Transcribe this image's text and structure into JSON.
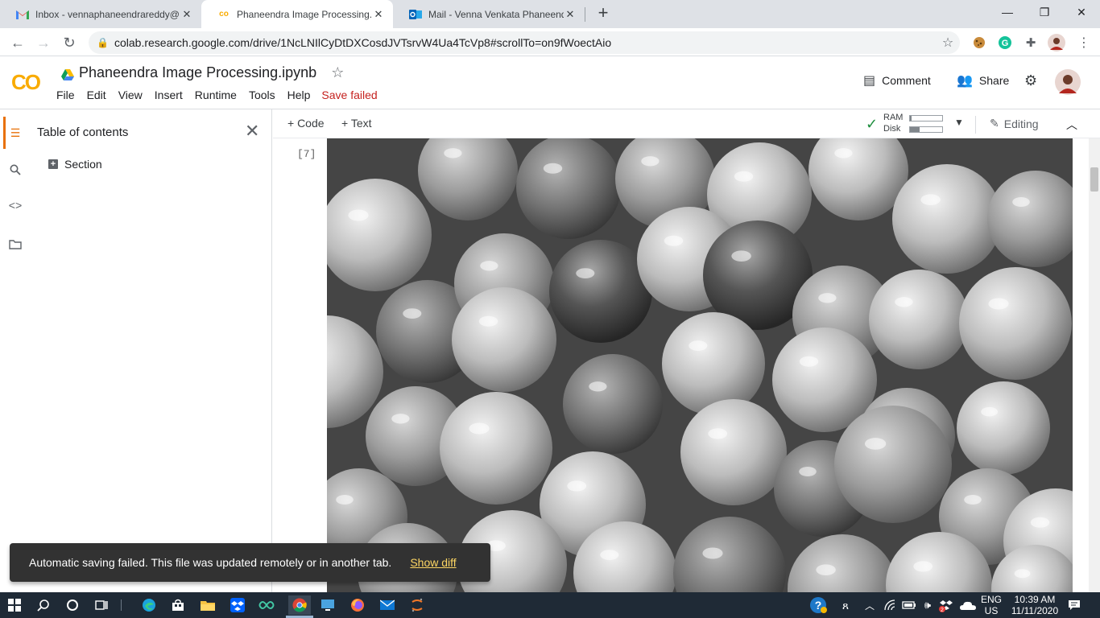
{
  "browser": {
    "tabs": [
      {
        "title": "Inbox - vennaphaneendrareddy@",
        "icon": "gmail-icon"
      },
      {
        "title": "Phaneendra Image Processing.ipynb",
        "icon": "colab-icon",
        "active": true
      },
      {
        "title": "Mail - Venna Venkata Phaneendra",
        "icon": "outlook-icon"
      }
    ],
    "new_tab": "+",
    "url": "colab.research.google.com/drive/1NcLNIlCyDtDXCosdJVTsrvW4Ua4TcVp8#scrollTo=on9fWoectAio"
  },
  "colab": {
    "logo": "CO",
    "doc_title": "Phaneendra Image Processing.ipynb",
    "menu": [
      "File",
      "Edit",
      "View",
      "Insert",
      "Runtime",
      "Tools",
      "Help"
    ],
    "save_status": "Save failed",
    "comment_label": "Comment",
    "share_label": "Share",
    "accent": "#e8710a"
  },
  "toc": {
    "title": "Table of contents",
    "items": [
      "Section"
    ]
  },
  "notebook": {
    "add_code": "+ Code",
    "add_text": "+ Text",
    "ram_label": "RAM",
    "disk_label": "Disk",
    "ram_fraction": 0.05,
    "disk_fraction": 0.3,
    "editing_label": "Editing",
    "exec_count": "[7]"
  },
  "snackbar": {
    "message": "Automatic saving failed. This file was updated remotely or in another tab.",
    "action": "Show diff"
  },
  "taskbar": {
    "lang_top": "ENG",
    "lang_bottom": "US",
    "time": "10:39 AM",
    "date": "11/11/2020",
    "badge": "2"
  }
}
